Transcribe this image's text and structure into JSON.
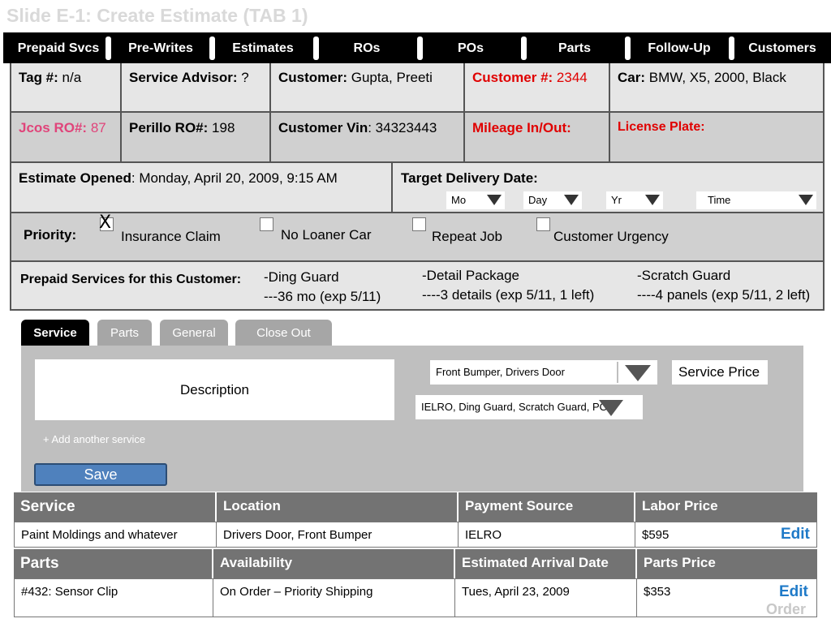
{
  "slide_title": "Slide E-1: Create Estimate (TAB 1)",
  "nav": [
    "Prepaid Svcs",
    "Pre-Writes",
    "Estimates",
    "ROs",
    "POs",
    "Parts",
    "Follow-Up",
    "Customers"
  ],
  "info": {
    "tag_label": "Tag #:",
    "tag_value": "n/a",
    "advisor_label": "Service Advisor:",
    "advisor_value": "?",
    "customer_label": "Customer:",
    "customer_value": "Gupta, Preeti",
    "customer_num_label": "Customer #:",
    "customer_num_value": "2344",
    "car_label": "Car:",
    "car_value": "BMW, X5, 2000, Black",
    "jcos_label": "Jcos RO#:",
    "jcos_value": "87",
    "perillo_label": "Perillo RO#:",
    "perillo_value": "198",
    "vin_label": "Customer Vin",
    "vin_value": ": 34323443",
    "mileage_label": "Mileage In/Out:",
    "plate_label": "License Plate:",
    "opened_label": "Estimate Opened",
    "opened_value": ": Monday, April 20, 2009, 9:15 AM",
    "target_label": "Target Delivery Date:",
    "date_selects": [
      "Mo",
      "Day",
      "Yr",
      "Time"
    ]
  },
  "priority": {
    "label": "Priority:",
    "options": [
      {
        "label": "Insurance Claim",
        "checked": true,
        "mark": "X"
      },
      {
        "label": "No Loaner Car",
        "checked": false
      },
      {
        "label": "Repeat Job",
        "checked": false
      },
      {
        "label": "Customer Urgency",
        "checked": false
      }
    ]
  },
  "prepaid": {
    "label": "Prepaid Services for this Customer:",
    "items": [
      {
        "line1": "-Ding Guard",
        "line2": "---36 mo (exp 5/11)"
      },
      {
        "line1": "-Detail  Package",
        "line2": "----3 details (exp 5/11, 1 left)"
      },
      {
        "line1": "-Scratch Guard",
        "line2": "----4 panels (exp 5/11, 2 left)"
      }
    ]
  },
  "tabs": [
    "Service",
    "Parts",
    "General",
    "Close Out"
  ],
  "form": {
    "description": "Description",
    "location_select": "Front Bumper, Drivers Door",
    "payment_select": "IELRO, Ding Guard, Scratch Guard,  PO",
    "service_price": "Service Price",
    "add_service": "+ Add another service",
    "save": "Save"
  },
  "services_table": {
    "headers": [
      "Service",
      "Location",
      "Payment Source",
      "Labor Price"
    ],
    "rows": [
      [
        "Paint Moldings and whatever",
        "Drivers Door, Front Bumper",
        "IELRO",
        "$595"
      ]
    ],
    "edit": "Edit"
  },
  "parts_table": {
    "headers": [
      "Parts",
      "Availability",
      "Estimated Arrival Date",
      "Parts Price"
    ],
    "rows": [
      [
        "#432:  Sensor Clip",
        "On Order – Priority Shipping",
        "Tues, April 23, 2009",
        "$353"
      ]
    ],
    "edit": "Edit",
    "order": "Order"
  }
}
